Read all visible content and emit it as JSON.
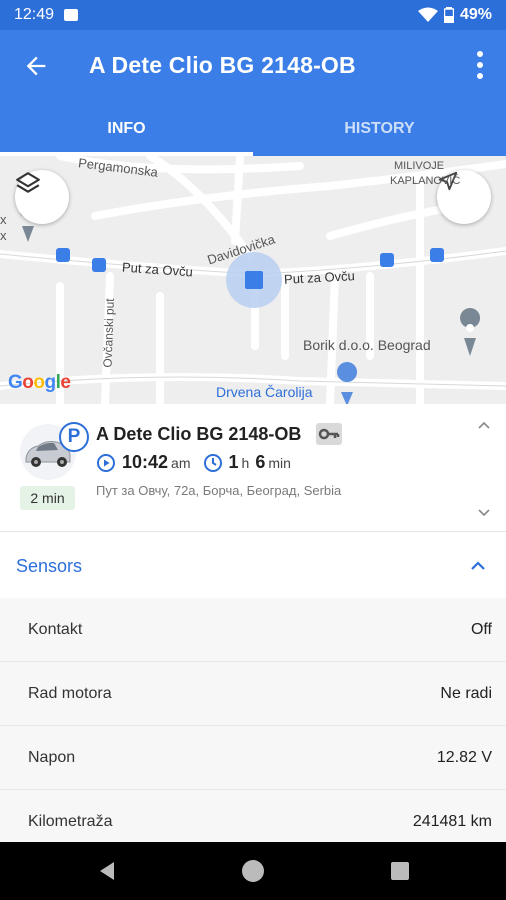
{
  "status_bar": {
    "time": "12:49",
    "battery": "49%"
  },
  "app_bar": {
    "title": "A Dete Clio BG 2148-OB"
  },
  "tabs": [
    {
      "label": "INFO",
      "active": true
    },
    {
      "label": "HISTORY",
      "active": false
    }
  ],
  "map": {
    "labels": {
      "pergamonska": "Pergamonska",
      "milivoje": "MILIVOJE",
      "kaplanovic": "KAPLANOVIĆ",
      "davidovicka": "Davidovička",
      "put_za_ovcu_left": "Put za Ovču",
      "put_za_ovcu_right": "Put za Ovču",
      "ovcanski_put": "Ovčanski put",
      "borik": "Borik d.o.o. Beograd",
      "drvena": "Drvena Čarolija",
      "edge_x1": "x",
      "edge_x2": "x"
    },
    "attribution": "Google"
  },
  "vehicle": {
    "name": "A Dete Clio BG 2148-OB",
    "parking_badge": "P",
    "duration_badge": "2 min",
    "time_value": "10:42",
    "time_suffix": "am",
    "elapsed_h_value": "1",
    "elapsed_h_unit": "h",
    "elapsed_m_value": "6",
    "elapsed_m_unit": "min",
    "address": "Пут за Овчу, 72а, Борча, Београд, Serbia"
  },
  "sensors": {
    "title": "Sensors",
    "rows": [
      {
        "name": "Kontakt",
        "value": "Off"
      },
      {
        "name": "Rad motora",
        "value": "Ne radi"
      },
      {
        "name": "Napon",
        "value": "12.82 V"
      },
      {
        "name": "Kilometraža",
        "value": "241481 km"
      }
    ]
  },
  "colors": {
    "primary": "#3b7ee8",
    "status_bar": "#2d6fd9",
    "accent": "#2d6fd9",
    "badge_green": "#e5f3e7"
  }
}
